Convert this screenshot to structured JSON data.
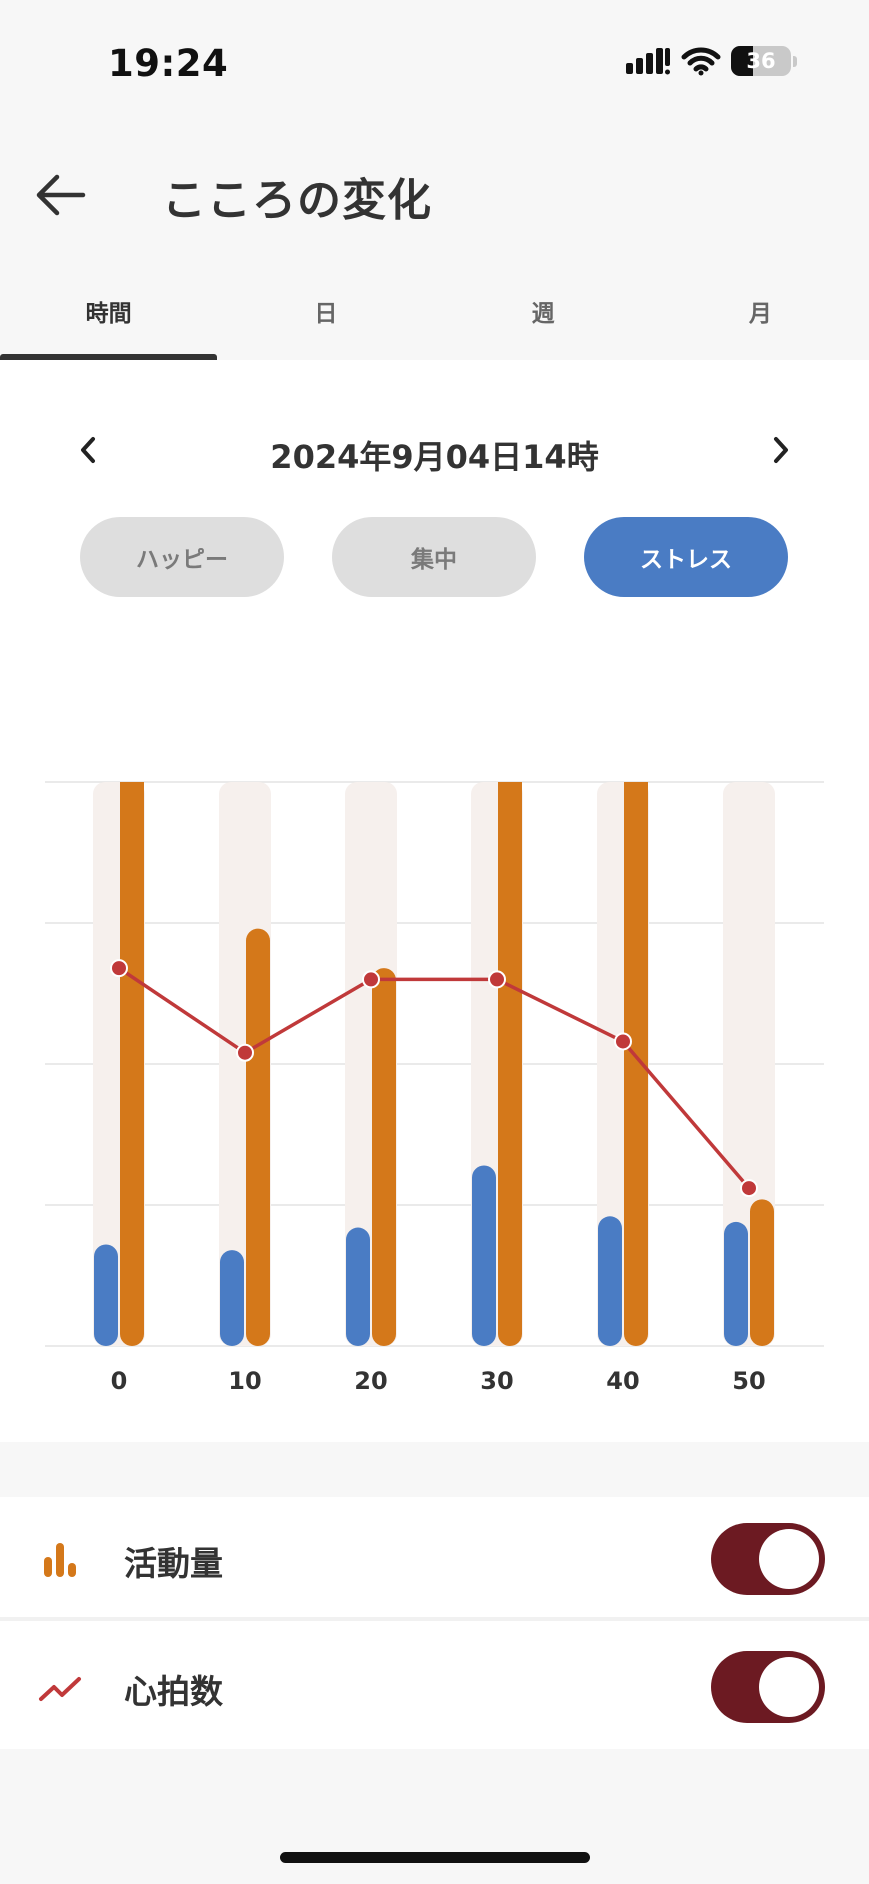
{
  "status_bar": {
    "time": "19:24",
    "battery": "36"
  },
  "header": {
    "title": "こころの変化"
  },
  "tabs": [
    {
      "label": "時間",
      "active": true
    },
    {
      "label": "日",
      "active": false
    },
    {
      "label": "週",
      "active": false
    },
    {
      "label": "月",
      "active": false
    }
  ],
  "date_nav": {
    "label": "2024年9月04日14時"
  },
  "modes": [
    {
      "label": "ハッピー",
      "active": false
    },
    {
      "label": "集中",
      "active": false
    },
    {
      "label": "ストレス",
      "active": true
    }
  ],
  "legend": {
    "activity_label": "活動量",
    "activity_on": true,
    "heart_rate_label": "心拍数",
    "heart_rate_on": true
  },
  "colors": {
    "stress_bar": "#4a7cc4",
    "activity_bar": "#d4781a",
    "heart_rate_line": "#c0393a",
    "track": "#f6f0ed",
    "toggle_on": "#6c1a22"
  },
  "chart_data": {
    "type": "bar",
    "categories": [
      "0",
      "10",
      "20",
      "30",
      "40",
      "50"
    ],
    "ylim": [
      0,
      100
    ],
    "grid": true,
    "series": [
      {
        "name": "ストレス",
        "kind": "bar",
        "values": [
          18,
          17,
          21,
          32,
          23,
          22
        ]
      },
      {
        "name": "活動量",
        "kind": "bar",
        "values": [
          100,
          74,
          67,
          100,
          100,
          26
        ]
      },
      {
        "name": "心拍数",
        "kind": "line",
        "values": [
          67,
          52,
          65,
          65,
          54,
          28
        ]
      }
    ]
  }
}
